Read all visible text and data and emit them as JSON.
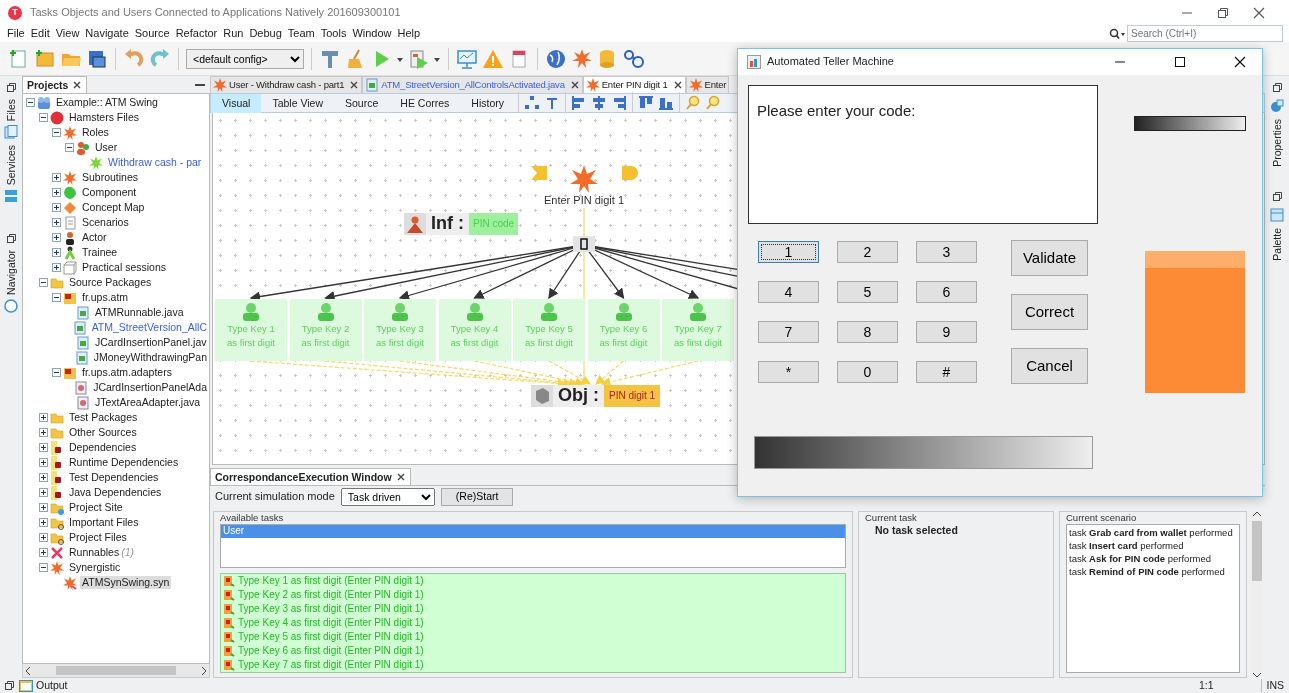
{
  "window": {
    "app_icon_letter": "T",
    "title": "Tasks Objects and Users Connected to Applications Natively 201609300101"
  },
  "menu": [
    "File",
    "Edit",
    "View",
    "Navigate",
    "Source",
    "Refactor",
    "Run",
    "Debug",
    "Team",
    "Tools",
    "Window",
    "Help"
  ],
  "search": {
    "placeholder": "Search (Ctrl+I)"
  },
  "toolbar": {
    "config": "<default config>"
  },
  "left_side_tabs": [
    {
      "label": "Files",
      "kind": "files"
    },
    {
      "label": "Services",
      "kind": "services"
    },
    {
      "label": "Navigator",
      "kind": "navigator"
    }
  ],
  "projects_panel": {
    "title": "Projects",
    "tree": [
      {
        "label": "Example:: ATM Swing",
        "kind": "project",
        "expanded": true,
        "selected": false,
        "children": [
          {
            "label": "Hamsters Files",
            "kind": "hamsters",
            "expanded": true,
            "selected": false,
            "children": [
              {
                "label": "Roles",
                "kind": "splat",
                "expanded": true,
                "selected": false,
                "children": [
                  {
                    "label": "User",
                    "kind": "user",
                    "expanded": true,
                    "selected": false,
                    "children": [
                      {
                        "label": "Withdraw cash - par",
                        "kind": "splatgreen",
                        "selected": false,
                        "open": true
                      }
                    ]
                  }
                ]
              },
              {
                "label": "Subroutines",
                "kind": "splat",
                "expanded": false,
                "selected": false
              },
              {
                "label": "Component",
                "kind": "component",
                "expanded": false,
                "selected": false
              },
              {
                "label": "Concept Map",
                "kind": "concept",
                "expanded": false,
                "selected": false
              },
              {
                "label": "Scenarios",
                "kind": "scenarios",
                "expanded": false,
                "selected": false
              },
              {
                "label": "Actor",
                "kind": "actor",
                "expanded": false,
                "selected": false
              },
              {
                "label": "Trainee",
                "kind": "trainee",
                "expanded": false,
                "selected": false
              },
              {
                "label": "Practical sessions",
                "kind": "sessions",
                "expanded": false,
                "selected": false
              }
            ]
          },
          {
            "label": "Source Packages",
            "kind": "folder",
            "expanded": true,
            "selected": false,
            "children": [
              {
                "label": "fr.ups.atm",
                "kind": "package",
                "expanded": true,
                "selected": false,
                "children": [
                  {
                    "label": "ATMRunnable.java",
                    "kind": "java",
                    "selected": false,
                    "open": false
                  },
                  {
                    "label": "ATM_StreetVersion_AllC",
                    "kind": "java",
                    "selected": false,
                    "open": true
                  },
                  {
                    "label": "JCardInsertionPanel.jav",
                    "kind": "java",
                    "selected": false,
                    "open": false
                  },
                  {
                    "label": "JMoneyWithdrawingPan",
                    "kind": "java",
                    "selected": false,
                    "open": false
                  }
                ]
              },
              {
                "label": "fr.ups.atm.adapters",
                "kind": "package",
                "expanded": true,
                "selected": false,
                "children": [
                  {
                    "label": "JCardInsertionPanelAda",
                    "kind": "adapter",
                    "selected": false,
                    "open": false
                  },
                  {
                    "label": "JTextAreaAdapter.java",
                    "kind": "adapter",
                    "selected": false,
                    "open": false
                  }
                ]
              }
            ]
          },
          {
            "label": "Test Packages",
            "kind": "folder",
            "expanded": false,
            "selected": false
          },
          {
            "label": "Other Sources",
            "kind": "folder",
            "expanded": false,
            "selected": false
          },
          {
            "label": "Dependencies",
            "kind": "dependency",
            "expanded": false,
            "selected": false
          },
          {
            "label": "Runtime Dependencies",
            "kind": "dependency",
            "expanded": false,
            "selected": false
          },
          {
            "label": "Test Dependencies",
            "kind": "dependency",
            "expanded": false,
            "selected": false
          },
          {
            "label": "Java Dependencies",
            "kind": "dependency",
            "expanded": false,
            "selected": false
          },
          {
            "label": "Project Site",
            "kind": "site",
            "expanded": false,
            "selected": false
          },
          {
            "label": "Important Files",
            "kind": "files",
            "expanded": false,
            "selected": false
          },
          {
            "label": "Project Files",
            "kind": "files",
            "expanded": false,
            "selected": false
          },
          {
            "label": "Runnables",
            "kind": "runnables",
            "count": "(1)",
            "expanded": false,
            "selected": false
          },
          {
            "label": "Synergistic",
            "kind": "splat",
            "expanded": true,
            "selected": false,
            "children": [
              {
                "label": "ATMSynSwing.syn",
                "kind": "syn",
                "selected": true,
                "open": false
              }
            ]
          }
        ]
      }
    ]
  },
  "editor_tabs": [
    {
      "label": "User - Withdraw cash - part1",
      "kind": "task",
      "selected": false,
      "closable": true
    },
    {
      "label": "ATM_StreetVersion_AllControlsActivated.java",
      "kind": "java",
      "selected": false,
      "closable": true
    },
    {
      "label": "Enter PIN digit 1",
      "kind": "task",
      "selected": true,
      "closable": true
    },
    {
      "label": "Enter",
      "kind": "task",
      "selected": false,
      "closable": false
    }
  ],
  "view_tabs": [
    {
      "label": "Visual",
      "selected": true
    },
    {
      "label": "Table View",
      "selected": false
    },
    {
      "label": "Source",
      "selected": false
    },
    {
      "label": "HE Corres",
      "selected": false
    },
    {
      "label": "History",
      "selected": false
    }
  ],
  "diagram": {
    "task": {
      "label": "Enter PIN digit 1"
    },
    "information": {
      "label": "Inf :",
      "value": "PIN code"
    },
    "object": {
      "label": "Obj :",
      "value": "PIN digit 1"
    },
    "subtasks": [
      "Type Key 1 as first digit",
      "Type Key 2 as first digit",
      "Type Key 3 as first digit",
      "Type Key 4 as first digit",
      "Type Key 5 as first digit",
      "Type Key 6 as first digit",
      "Type Key 7 as first digit"
    ]
  },
  "right_side_tabs": [
    {
      "label": "Properties"
    },
    {
      "label": "Palette"
    }
  ],
  "execution_panel": {
    "tab": "CorrespondanceExecution Window",
    "mode_label": "Current simulation mode",
    "mode": "Task driven",
    "restart_button": "(Re)Start",
    "available_tasks": {
      "title": "Available tasks",
      "roles": [
        {
          "label": "User",
          "selected": true
        }
      ],
      "tasks": [
        "Type Key 1 as first digit (Enter PIN digit 1)",
        "Type Key 2 as first digit (Enter PIN digit 1)",
        "Type Key 3 as first digit (Enter PIN digit 1)",
        "Type Key 4 as first digit (Enter PIN digit 1)",
        "Type Key 5 as first digit (Enter PIN digit 1)",
        "Type Key 6 as first digit (Enter PIN digit 1)",
        "Type Key 7 as first digit (Enter PIN digit 1)"
      ]
    },
    "current_task": {
      "title": "Current task",
      "text": "No task selected"
    },
    "current_scenario": {
      "title": "Current scenario",
      "lines": [
        "task **Grab card from wallet** performed",
        "task **Insert card** performed",
        "task **Ask for PIN code** performed",
        "task **Remind of PIN code** performed"
      ]
    }
  },
  "status_bar": {
    "output": "Output",
    "position": "1:1",
    "mode": "INS"
  },
  "atm_window": {
    "title": "Automated Teller Machine",
    "display_text": "Please enter your code:",
    "keys": [
      {
        "label": "1",
        "focused": true
      },
      {
        "label": "2",
        "focused": false
      },
      {
        "label": "3",
        "focused": false
      },
      {
        "label": "4",
        "focused": false
      },
      {
        "label": "5",
        "focused": false
      },
      {
        "label": "6",
        "focused": false
      },
      {
        "label": "7",
        "focused": false
      },
      {
        "label": "8",
        "focused": false
      },
      {
        "label": "9",
        "focused": false
      },
      {
        "label": "*",
        "focused": false
      },
      {
        "label": "0",
        "focused": false
      },
      {
        "label": "#",
        "focused": false
      }
    ],
    "actions": [
      "Validate",
      "Correct",
      "Cancel"
    ]
  }
}
